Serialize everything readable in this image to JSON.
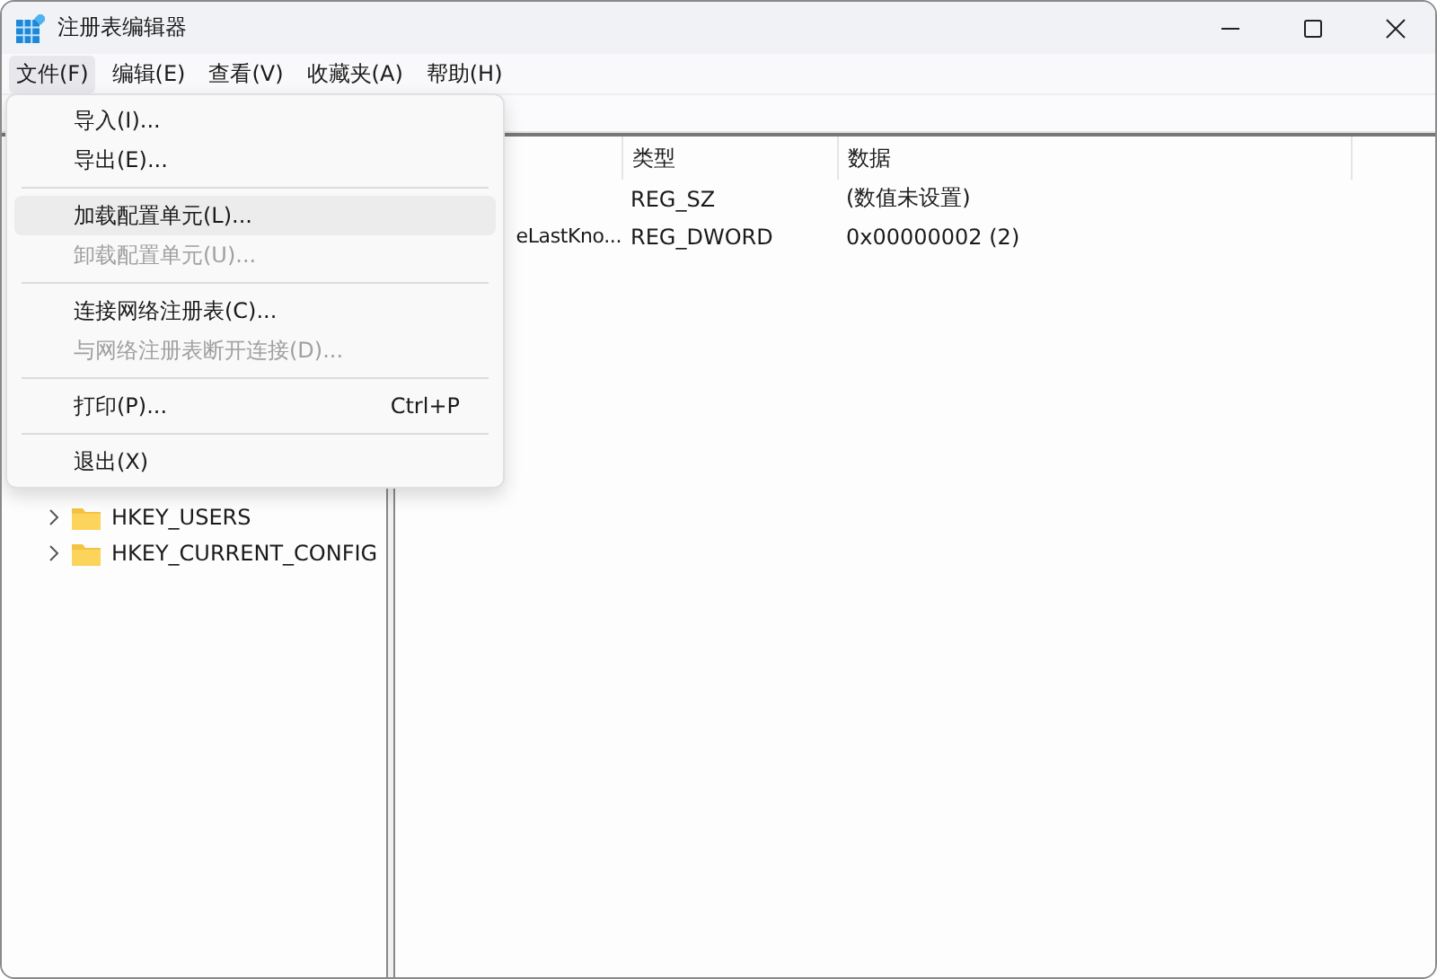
{
  "window": {
    "title": "注册表编辑器"
  },
  "menu_bar": [
    {
      "label": "文件(F)",
      "selected": true
    },
    {
      "label": "编辑(E)",
      "selected": false
    },
    {
      "label": "查看(V)",
      "selected": false
    },
    {
      "label": "收藏夹(A)",
      "selected": false
    },
    {
      "label": "帮助(H)",
      "selected": false
    }
  ],
  "file_menu": [
    {
      "kind": "item",
      "label": "导入(I)...",
      "disabled": false,
      "selected": false
    },
    {
      "kind": "item",
      "label": "导出(E)...",
      "disabled": false,
      "selected": false
    },
    {
      "kind": "separator"
    },
    {
      "kind": "item",
      "label": "加载配置单元(L)...",
      "disabled": false,
      "selected": true
    },
    {
      "kind": "item",
      "label": "卸载配置单元(U)...",
      "disabled": true,
      "selected": false
    },
    {
      "kind": "separator"
    },
    {
      "kind": "item",
      "label": "连接网络注册表(C)...",
      "disabled": false,
      "selected": false
    },
    {
      "kind": "item",
      "label": "与网络注册表断开连接(D)...",
      "disabled": true,
      "selected": false
    },
    {
      "kind": "separator"
    },
    {
      "kind": "item",
      "label": "打印(P)...",
      "shortcut": "Ctrl+P",
      "disabled": false,
      "selected": false
    },
    {
      "kind": "separator"
    },
    {
      "kind": "item",
      "label": "退出(X)",
      "disabled": false,
      "selected": false
    }
  ],
  "tree": [
    {
      "label": "HKEY_USERS",
      "expanded": false
    },
    {
      "label": "HKEY_CURRENT_CONFIG",
      "expanded": false
    }
  ],
  "table": {
    "columns": [
      "类型",
      "数据"
    ],
    "rows": [
      {
        "type": "REG_SZ",
        "data": "(数值未设置)"
      },
      {
        "name": "eLastKno...",
        "type": "REG_DWORD",
        "data": "0x00000002 (2)"
      }
    ]
  }
}
